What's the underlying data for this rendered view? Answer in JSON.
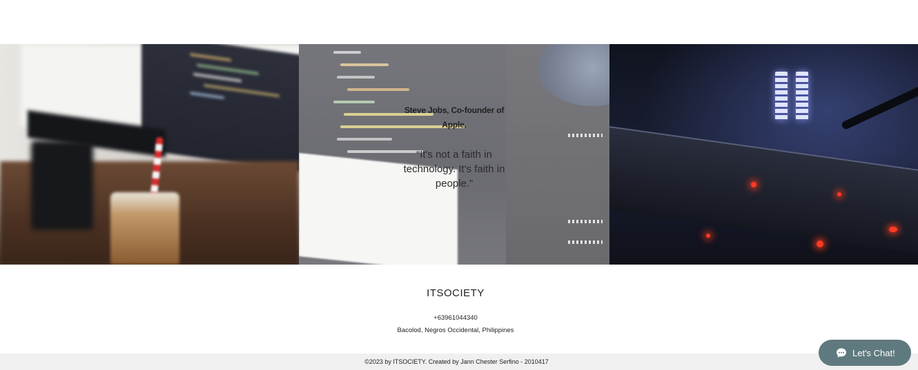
{
  "hero": {
    "quote_author": "Steve Jobs, Co-founder of Apple.",
    "quote_text": "“It's not a faith in technology. It's faith in people.”"
  },
  "footer": {
    "brand": "ITSOCIETY",
    "phone": "+63961044340",
    "address": "Bacolod, Negros Occidental, Philippines",
    "copyright": "©2023 by ITSOCIETY. Created by Jann Chester Serfino - 2010417"
  },
  "chat": {
    "label": "Let's Chat!",
    "icon": "chat-bubble-icon",
    "color": "#5f7a7e"
  }
}
